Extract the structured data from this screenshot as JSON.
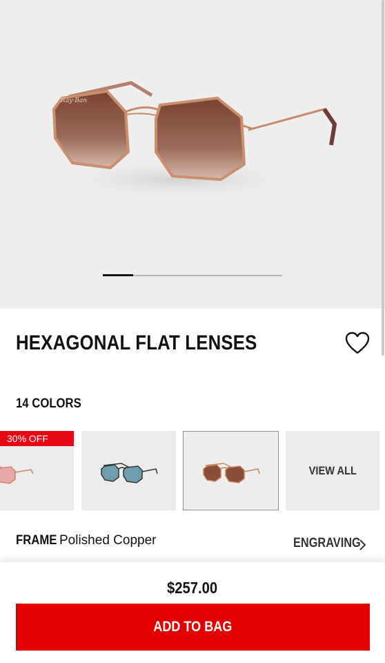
{
  "product": {
    "title": "HEXAGONAL FLAT LENSES",
    "carousel": {
      "current_index": 1,
      "total_images": 6
    }
  },
  "colors": {
    "count_label": "14 COLORS",
    "swatches": [
      {
        "badge": "30% OFF",
        "lens_color": "#e8a7a8",
        "frame_color": "#c9866a"
      },
      {
        "lens_color": "#6f9fae",
        "frame_color": "#333333"
      },
      {
        "lens_color": "#8a4f3a",
        "frame_color": "#c7855f",
        "selected": true
      },
      {
        "label": "VIEW ALL"
      }
    ]
  },
  "frame": {
    "label": "FRAME",
    "value": "Polished Copper"
  },
  "engraving": {
    "label": "ENGRAVING"
  },
  "purchase": {
    "price": "$257.00",
    "button_label": "ADD TO BAG"
  },
  "theme": {
    "accent": "#e50000",
    "badge": "#e50914"
  }
}
